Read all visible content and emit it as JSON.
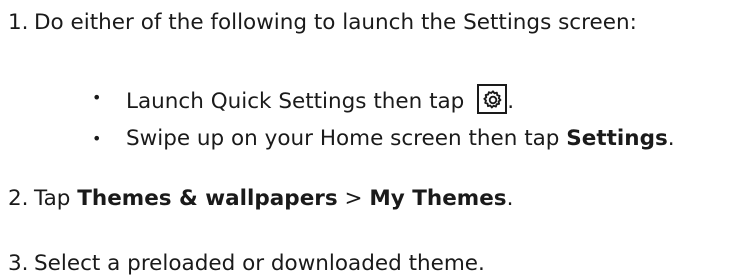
{
  "steps": [
    {
      "number": "1.",
      "text": "Do either of the following to launch the Settings screen:",
      "bullets": [
        {
          "marker": "•",
          "text": "Launch Quick Settings then tap",
          "suffix": ".",
          "icon": "settings-gear-icon"
        },
        {
          "marker": "•",
          "text": "Swipe up on your Home screen then tap ",
          "bold": "Settings",
          "suffix": "."
        }
      ]
    },
    {
      "number": "2.",
      "text_before": "Tap ",
      "bold1": "Themes & wallpapers",
      "separator": " > ",
      "bold2": "My Themes",
      "suffix": "."
    },
    {
      "number": "3.",
      "text": "Select a preloaded or downloaded theme."
    }
  ]
}
